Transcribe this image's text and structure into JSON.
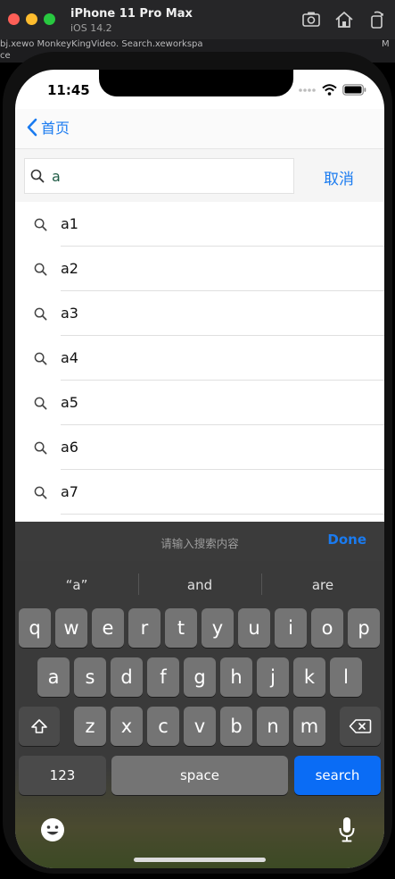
{
  "simulator": {
    "device_name": "iPhone 11 Pro Max",
    "os_version": "iOS 14.2",
    "background_left": "bj.xewo  MonkeyKingVideo.  Search.xeworkspa",
    "background_left2": "ce",
    "background_right": "M"
  },
  "status_bar": {
    "time": "11:45"
  },
  "nav": {
    "back_label": "首页"
  },
  "search": {
    "query": "a",
    "cancel_label": "取消"
  },
  "results": [
    {
      "label": "a1"
    },
    {
      "label": "a2"
    },
    {
      "label": "a3"
    },
    {
      "label": "a4"
    },
    {
      "label": "a5"
    },
    {
      "label": "a6"
    },
    {
      "label": "a7"
    }
  ],
  "accessory": {
    "placeholder": "请输入搜索内容",
    "done_label": "Done"
  },
  "keyboard": {
    "suggestions": [
      "“a”",
      "and",
      "are"
    ],
    "row1": [
      "q",
      "w",
      "e",
      "r",
      "t",
      "y",
      "u",
      "i",
      "o",
      "p"
    ],
    "row2": [
      "a",
      "s",
      "d",
      "f",
      "g",
      "h",
      "j",
      "k",
      "l"
    ],
    "row3": [
      "z",
      "x",
      "c",
      "v",
      "b",
      "n",
      "m"
    ],
    "numbers_label": "123",
    "space_label": "space",
    "search_label": "search"
  },
  "colors": {
    "accent": "#1a7bf0",
    "search_key": "#0a6cf5",
    "keyboard_bg": "#3a3a3a"
  }
}
